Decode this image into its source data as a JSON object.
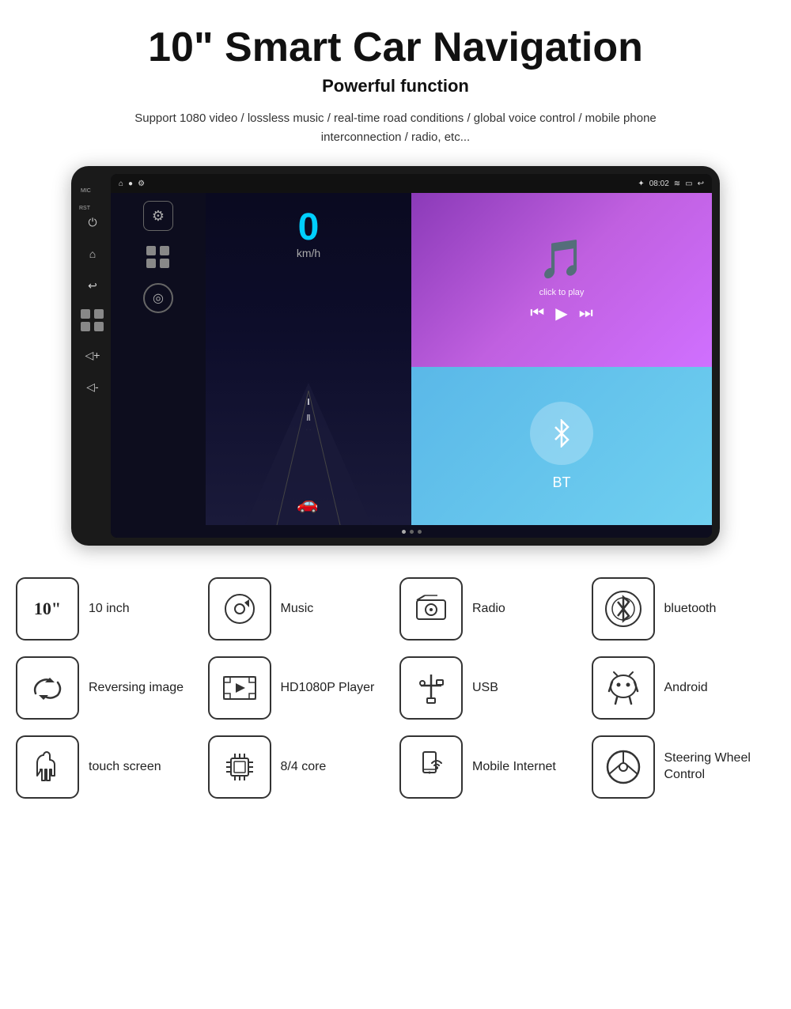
{
  "header": {
    "main_title": "10\" Smart Car Navigation",
    "sub_title": "Powerful function",
    "description": "Support 1080 video / lossless music / real-time road conditions / global voice control / mobile phone interconnection / radio, etc..."
  },
  "device": {
    "mic_label": "MIC",
    "rst_label": "RST",
    "status_bar": {
      "time": "08:02",
      "bluetooth_icon": "bluetooth",
      "signal_icon": "signal",
      "back_icon": "back"
    },
    "speed": {
      "value": "0",
      "unit": "km/h"
    },
    "music": {
      "click_to_play": "click to play"
    },
    "bt": {
      "label": "BT"
    }
  },
  "features": [
    {
      "id": "size",
      "icon_symbol": "10\"",
      "label": "10 inch",
      "icon_type": "text"
    },
    {
      "id": "music",
      "icon_symbol": "♪",
      "label": "Music",
      "icon_type": "music"
    },
    {
      "id": "radio",
      "icon_symbol": "📻",
      "label": "Radio",
      "icon_type": "radio"
    },
    {
      "id": "bluetooth",
      "icon_symbol": "bluetooth",
      "label": "bluetooth",
      "icon_type": "bt"
    },
    {
      "id": "reversing",
      "icon_symbol": "⇋",
      "label": "Reversing image",
      "icon_type": "reverse"
    },
    {
      "id": "player",
      "icon_symbol": "▶",
      "label": "HD1080P Player",
      "icon_type": "film"
    },
    {
      "id": "usb",
      "icon_symbol": "USB",
      "label": "USB",
      "icon_type": "usb"
    },
    {
      "id": "android",
      "icon_symbol": "🤖",
      "label": "Android",
      "icon_type": "android"
    },
    {
      "id": "touch",
      "icon_symbol": "👆",
      "label": "touch screen",
      "icon_type": "touch"
    },
    {
      "id": "core",
      "icon_symbol": "⊞",
      "label": "8/4 core",
      "icon_type": "chip"
    },
    {
      "id": "mobile",
      "icon_symbol": "📱",
      "label": "Mobile Internet",
      "icon_type": "mobile"
    },
    {
      "id": "steering",
      "icon_symbol": "⊙",
      "label": "Steering Wheel Control",
      "icon_type": "wheel"
    }
  ]
}
